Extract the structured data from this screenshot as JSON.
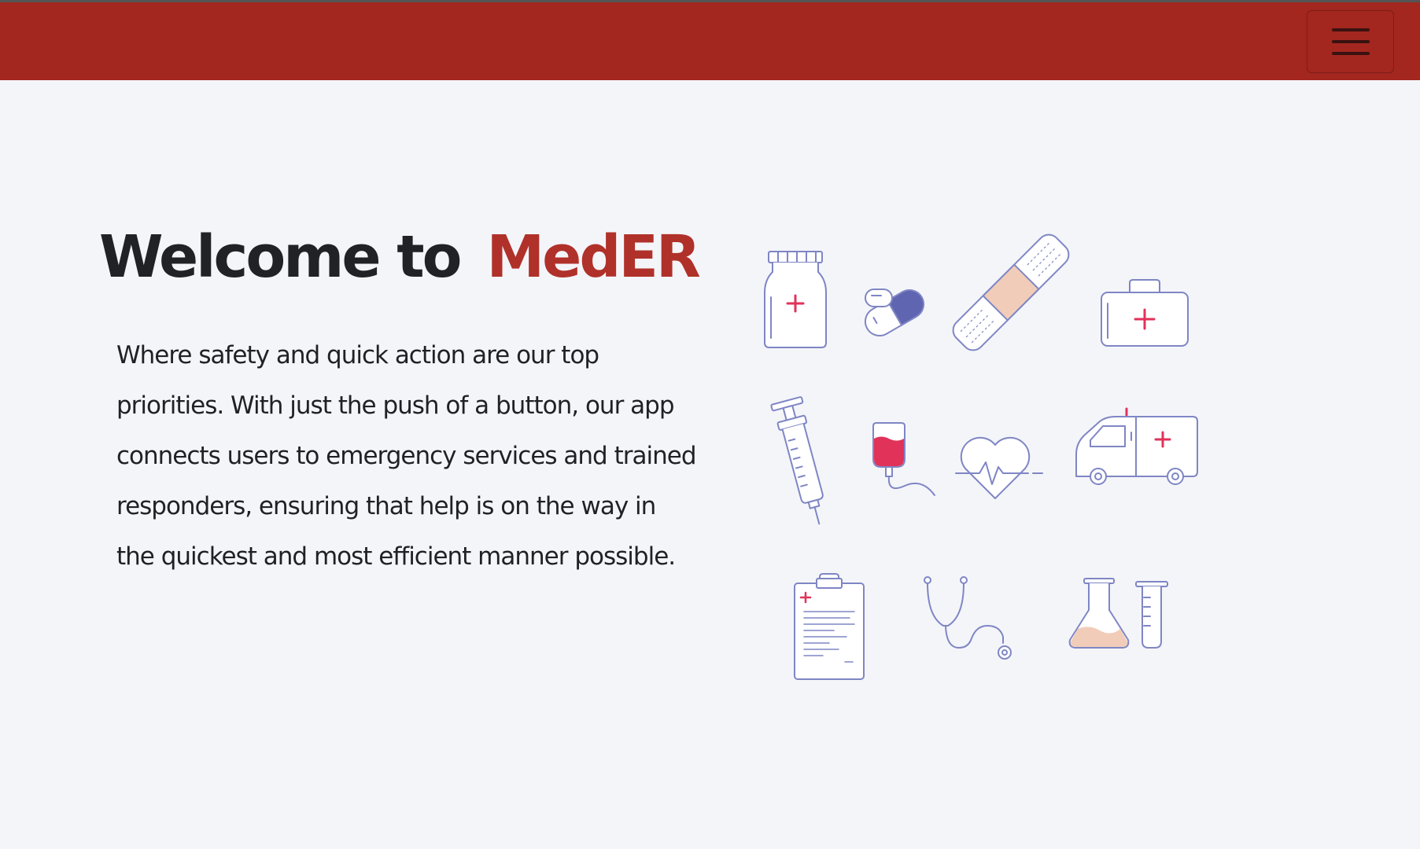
{
  "navbar": {
    "menu_icon": "hamburger-menu-icon",
    "color": "#a3271f"
  },
  "hero": {
    "title_prefix": "Welcome to",
    "title_brand": "MedER",
    "brand_color": "#b0312a",
    "description": "Where safety and quick action are our top priorities. With just the push of a button, our app connects users to emergency services and trained responders, ensuring that help is on the way in the quickest and most efficient manner possible."
  },
  "illustration": {
    "icons": [
      "medicine-bottle-icon",
      "pill-capsule-icon",
      "bandage-icon",
      "first-aid-kit-icon",
      "syringe-icon",
      "blood-bag-icon",
      "heartbeat-icon",
      "ambulance-icon",
      "clipboard-icon",
      "stethoscope-icon",
      "lab-flask-icon"
    ],
    "line_color": "#7f86c4",
    "accent_color": "#e1325a"
  }
}
